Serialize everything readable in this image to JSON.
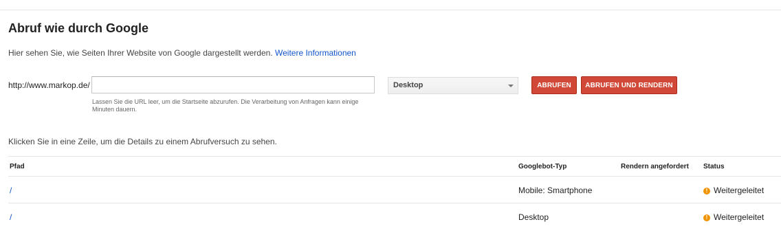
{
  "page": {
    "title": "Abruf wie durch Google",
    "intro_text": "Hier sehen Sie, wie Seiten Ihrer Website von Google dargestellt werden.",
    "intro_link": "Weitere Informationen"
  },
  "fetch_form": {
    "url_prefix": "http://www.markop.de/",
    "url_value": "",
    "hint": "Lassen Sie die URL leer, um die Startseite abzurufen. Die Verarbeitung von Anfragen kann einige Minuten dauern.",
    "device_selected": "Desktop",
    "fetch_button": "ABRUFEN",
    "fetch_render_button": "ABRUFEN UND RENDERN"
  },
  "history": {
    "instruction": "Klicken Sie in eine Zeile, um die Details zu einem Abrufversuch zu sehen.",
    "columns": [
      "Pfad",
      "Googlebot-Typ",
      "Rendern angefordert",
      "Status"
    ],
    "rows": [
      {
        "path": "/",
        "googlebot_type": "Mobile: Smartphone",
        "render_requested": "",
        "status": "Weitergeleitet",
        "status_icon": "warning-icon"
      },
      {
        "path": "/",
        "googlebot_type": "Desktop",
        "render_requested": "",
        "status": "Weitergeleitet",
        "status_icon": "warning-icon"
      }
    ]
  },
  "colors": {
    "link": "#1155cc",
    "button_red": "#d14836",
    "warning_orange": "#f09300"
  }
}
